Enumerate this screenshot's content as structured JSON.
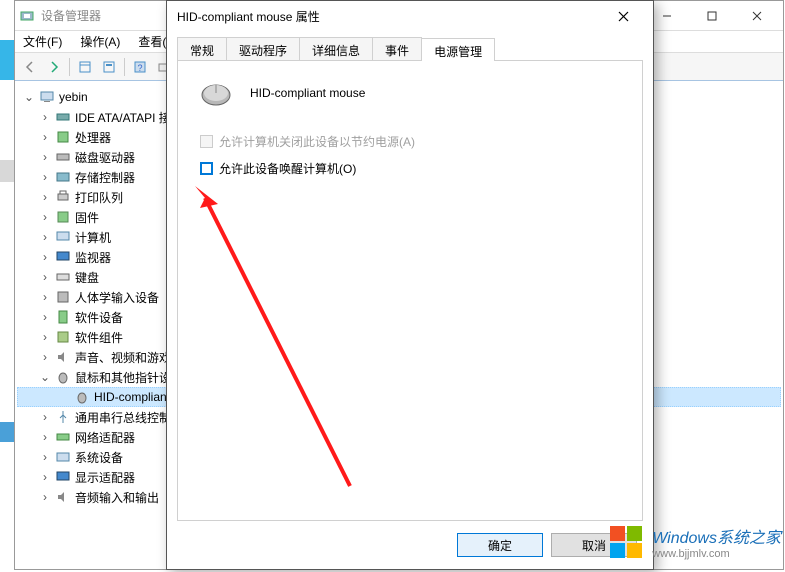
{
  "devmgr": {
    "title": "设备管理器",
    "menu": {
      "file": "文件(F)",
      "action": "操作(A)",
      "view": "查看(V"
    },
    "root": "yebin",
    "nodes": [
      "IDE ATA/ATAPI 接",
      "处理器",
      "磁盘驱动器",
      "存储控制器",
      "打印队列",
      "固件",
      "计算机",
      "监视器",
      "键盘",
      "人体学输入设备",
      "软件设备",
      "软件组件",
      "声音、视频和游戏",
      "鼠标和其他指针设",
      "通用串行总线控制",
      "网络适配器",
      "系统设备",
      "显示适配器",
      "音频输入和输出"
    ],
    "mouse_child": "HID-complian",
    "expand_open": "⌄",
    "expand_closed": "›"
  },
  "props": {
    "title": "HID-compliant mouse 属性",
    "tabs": {
      "general": "常规",
      "driver": "驱动程序",
      "details": "详细信息",
      "events": "事件",
      "power": "电源管理"
    },
    "device_name": "HID-compliant mouse",
    "opt_shutdown": "允许计算机关闭此设备以节约电源(A)",
    "opt_wake": "允许此设备唤醒计算机(O)",
    "ok": "确定",
    "cancel": "取消"
  },
  "watermark": {
    "main": "Windows系统之家",
    "sub": "www.bjjmlv.com"
  }
}
